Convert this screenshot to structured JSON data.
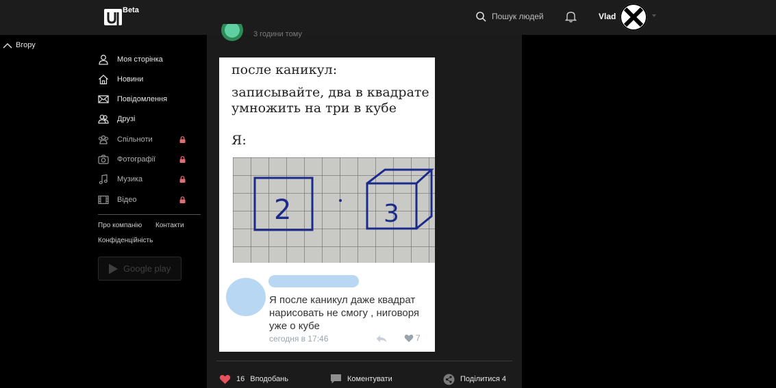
{
  "brand": {
    "badge": "Beta"
  },
  "header": {
    "search_placeholder": "Пошук людей",
    "user_name": "Vlad"
  },
  "back_to_top": "Вгору",
  "sidebar": {
    "items": [
      {
        "label": "Моя сторінка",
        "icon": "user-icon",
        "locked": false
      },
      {
        "label": "Новини",
        "icon": "home-icon",
        "locked": false
      },
      {
        "label": "Повідомлення",
        "icon": "mail-icon",
        "locked": false
      },
      {
        "label": "Друзі",
        "icon": "friends-icon",
        "locked": false
      },
      {
        "label": "Спільноти",
        "icon": "groups-icon",
        "locked": true
      },
      {
        "label": "Фотографії",
        "icon": "camera-icon",
        "locked": true
      },
      {
        "label": "Музика",
        "icon": "music-icon",
        "locked": true
      },
      {
        "label": "Відео",
        "icon": "film-icon",
        "locked": true
      }
    ],
    "footer_links": [
      "Про компанію",
      "Контакти",
      "Конфіденційність"
    ],
    "store_button": "Google play"
  },
  "post": {
    "time": "3 години тому",
    "image": {
      "line1": "после каникул:",
      "line2": "записывайте, два в квадрате",
      "line3": "умножить на три в кубе",
      "line4": "Я:",
      "square_digit": "2",
      "cube_digit": "3",
      "comment_text": "Я после каникул даже квадрат нарисовать не смогу , ниговоря уже о кубе",
      "comment_time": "сегодня в 17:46",
      "comment_likes": "7"
    },
    "likes_count": "16",
    "like_label": "Вподобань",
    "comment_label": "Коментувати",
    "share_label": "Поділитися 4"
  },
  "colors": {
    "accent_heart": "#e8505b",
    "topbar": "#1c1c1c",
    "feed_bg": "#1b1b1b",
    "lock": "#e06c75"
  }
}
